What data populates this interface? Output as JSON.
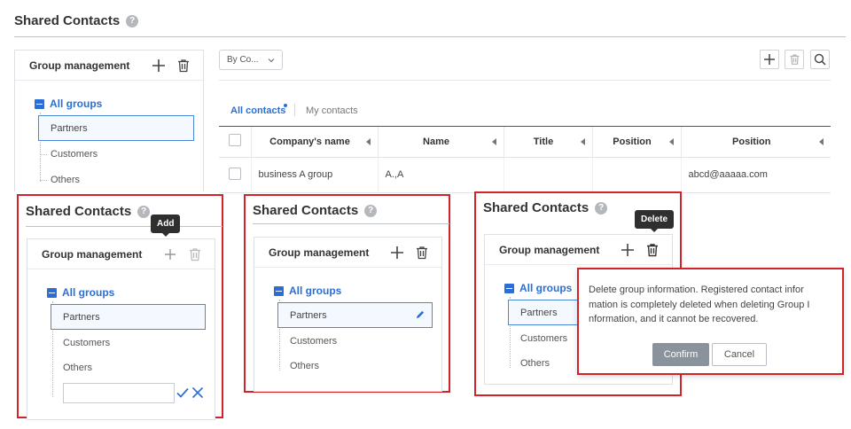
{
  "page": {
    "title": "Shared Contacts",
    "help": "?"
  },
  "group_panel": {
    "title": "Group management"
  },
  "tree": {
    "root": "All groups",
    "items": [
      "Partners",
      "Customers",
      "Others"
    ]
  },
  "toolbar": {
    "filter_select": "By Co..."
  },
  "tabs": {
    "all": "All contacts",
    "mine": "My contacts"
  },
  "table": {
    "headers": [
      "Company's name",
      "Name",
      "Title",
      "Position",
      "Position"
    ],
    "rows": [
      {
        "company": "business A group",
        "name": "A.,A",
        "title": "",
        "position": "",
        "email": "abcd@aaaaa.com"
      }
    ]
  },
  "tooltips": {
    "add": "Add",
    "delete": "Delete"
  },
  "dialog": {
    "line1": "Delete group information. Registered contact infor",
    "line2": "mation is completely deleted when deleting Group I",
    "line3": "nformation, and it cannot be recovered.",
    "confirm": "Confirm",
    "cancel": "Cancel"
  },
  "colors": {
    "accent": "#2b6fd6",
    "highlight_border": "#d2232a"
  }
}
